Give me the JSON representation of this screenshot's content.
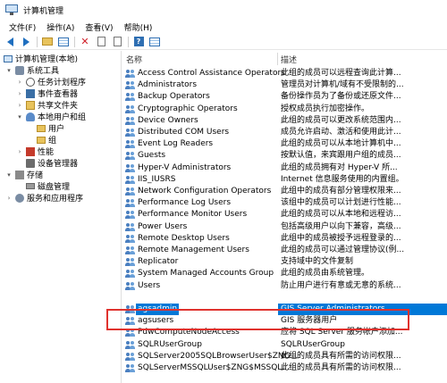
{
  "window": {
    "title": "计算机管理"
  },
  "menu": [
    "文件(F)",
    "操作(A)",
    "查看(V)",
    "帮助(H)"
  ],
  "toolbar": {
    "icons": [
      "back-arrow-icon",
      "forward-arrow-icon",
      "up-folder-icon",
      "show-hide-tree-icon",
      "delete-icon",
      "properties-icon",
      "export-icon",
      "help-icon",
      "view-icon"
    ]
  },
  "tree": {
    "root": "计算机管理(本地)",
    "system_tools": "系统工具",
    "task_scheduler": "任务计划程序",
    "event_viewer": "事件查看器",
    "shared_folders": "共享文件夹",
    "local_users_groups": "本地用户和组",
    "users": "用户",
    "groups": "组",
    "performance": "性能",
    "device_manager": "设备管理器",
    "storage": "存储",
    "disk_management": "磁盘管理",
    "services_apps": "服务和应用程序"
  },
  "list": {
    "col_name": "名称",
    "col_desc": "描述",
    "selected_index": 20,
    "rows": [
      {
        "name": "Access Control Assistance Operators",
        "desc": "此组的成员可以远程查询此计算..."
      },
      {
        "name": "Administrators",
        "desc": "管理员对计算机/域有不受限制的..."
      },
      {
        "name": "Backup Operators",
        "desc": "备份操作员为了备份或还原文件..."
      },
      {
        "name": "Cryptographic Operators",
        "desc": "授权成员执行加密操作。"
      },
      {
        "name": "Device Owners",
        "desc": "此组的成员可以更改系统范围内..."
      },
      {
        "name": "Distributed COM Users",
        "desc": "成员允许启动、激活和使用此计..."
      },
      {
        "name": "Event Log Readers",
        "desc": "此组的成员可以从本地计算机中..."
      },
      {
        "name": "Guests",
        "desc": "按默认值，来宾跟用户组的成员..."
      },
      {
        "name": "Hyper-V Administrators",
        "desc": "此组的成员拥有对 Hyper-V 所..."
      },
      {
        "name": "IIS_IUSRS",
        "desc": "Internet 信息服务使用的内置组。"
      },
      {
        "name": "Network Configuration Operators",
        "desc": "此组中的成员有部分管理权限来..."
      },
      {
        "name": "Performance Log Users",
        "desc": "该组中的成员可以计划进行性能..."
      },
      {
        "name": "Performance Monitor Users",
        "desc": "此组的成员可以从本地和远程访..."
      },
      {
        "name": "Power Users",
        "desc": "包括高级用户以向下兼容，高级..."
      },
      {
        "name": "Remote Desktop Users",
        "desc": "此组中的成员被授予远程登录的..."
      },
      {
        "name": "Remote Management Users",
        "desc": "此组的成员可以通过管理协议(例..."
      },
      {
        "name": "Replicator",
        "desc": "支持域中的文件复制"
      },
      {
        "name": "System Managed Accounts Group",
        "desc": "此组的成员由系统管理。"
      },
      {
        "name": "Users",
        "desc": "防止用户进行有意或无意的系统..."
      },
      {
        "name": "",
        "desc": ""
      },
      {
        "name": "agsadmin",
        "desc": "GIS Server Administrators"
      },
      {
        "name": "agsusers",
        "desc": "GIS 服务器用户"
      },
      {
        "name": "PdwComputeNodeAccess",
        "desc": "应将 SQL Server 服务帐户添加..."
      },
      {
        "name": "SQLRUserGroup",
        "desc": "SQLRUserGroup"
      },
      {
        "name": "SQLServer2005SQLBrowserUser$ZNG...",
        "desc": "此组的成员具有所需的访问权限..."
      },
      {
        "name": "SQLServerMSSQLUser$ZNG$MSSQL...",
        "desc": "此组的成员具有所需的访问权限..."
      }
    ]
  },
  "colors": {
    "selection": "#0078d7",
    "highlight_border": "#e0322e"
  }
}
